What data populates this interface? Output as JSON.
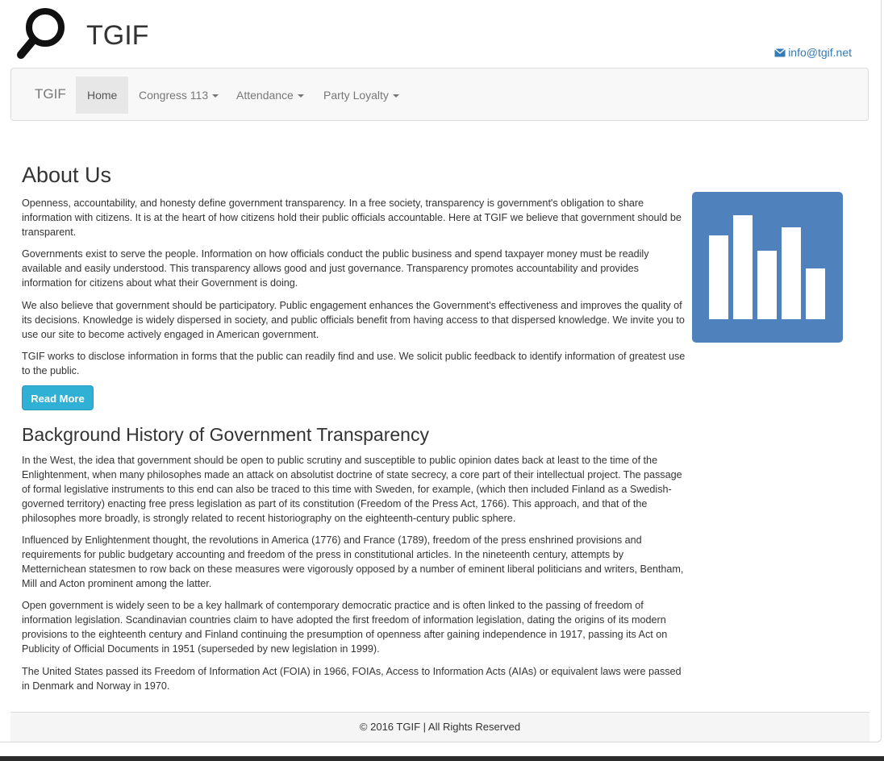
{
  "header": {
    "title": "TGIF",
    "logo_icon": "magnifier-icon",
    "contact_icon": "envelope-icon",
    "contact_email": "info@tgif.net"
  },
  "navbar": {
    "brand": "TGIF",
    "items": [
      {
        "label": "Home",
        "active": true,
        "dropdown": false
      },
      {
        "label": "Congress 113",
        "active": false,
        "dropdown": true
      },
      {
        "label": "Attendance",
        "active": false,
        "dropdown": true
      },
      {
        "label": "Party Loyalty",
        "active": false,
        "dropdown": true
      }
    ]
  },
  "about": {
    "heading": "About Us",
    "paragraphs": [
      "Openness, accountability, and honesty define government transparency. In a free society, transparency is government's obligation to share information with citizens. It is at the heart of how citizens hold their public officials accountable. Here at TGIF we believe that government should be transparent.",
      "Governments exist to serve the people. Information on how officials conduct the public business and spend taxpayer money must be readily available and easily understood. This transparency allows good and just governance. Transparency promotes accountability and provides information for citizens about what their Government is doing.",
      "We also believe that government should be participatory. Public engagement enhances the Government's effectiveness and improves the quality of its decisions. Knowledge is widely dispersed in society, and public officials benefit from having access to that dispersed knowledge. We invite you to use our site to become actively engaged in American government.",
      "TGIF works to disclose information in forms that the public can readily find and use. We solicit public feedback to identify information of greatest use to the public."
    ],
    "button_label": "Read More",
    "image_icon": "bar-chart-icon"
  },
  "history": {
    "heading": "Background History of Government Transparency",
    "paragraphs": [
      "In the West, the idea that government should be open to public scrutiny and susceptible to public opinion dates back at least to the time of the Enlightenment, when many philosophes made an attack on absolutist doctrine of state secrecy, a core part of their intellectual project. The passage of formal legislative instruments to this end can also be traced to this time with Sweden, for example, (which then included Finland as a Swedish-governed territory) enacting free press legislation as part of its constitution (Freedom of the Press Act, 1766). This approach, and that of the philosophes more broadly, is strongly related to recent historiography on the eighteenth-century public sphere.",
      "Influenced by Enlightenment thought, the revolutions in America (1776) and France (1789), freedom of the press enshrined provisions and requirements for public budgetary accounting and freedom of the press in constitutional articles. In the nineteenth century, attempts by Metternichean statesmen to row back on these measures were vigorously opposed by a number of eminent liberal politicians and writers, Bentham, Mill and Acton prominent among the latter.",
      "Open government is widely seen to be a key hallmark of contemporary democratic practice and is often linked to the passing of freedom of information legislation. Scandinavian countries claim to have adopted the first freedom of information legislation, dating the origins of its modern provisions to the eighteenth century and Finland continuing the presumption of openness after gaining independence in 1917, passing its Act on Publicity of Official Documents in 1951 (superseded by new legislation in 1999).",
      "The United States passed its Freedom of Information Act (FOIA) in 1966, FOIAs, Access to Information Acts (AIAs) or equivalent laws were passed in Denmark and Norway in 1970."
    ]
  },
  "footer": {
    "text": "© 2016 TGIF | All Rights Reserved"
  },
  "colors": {
    "primary_link": "#337ab7",
    "button_info": "#31b0d5",
    "chart_badge": "#4f81bd",
    "navbar_bg": "#f8f8f8"
  }
}
